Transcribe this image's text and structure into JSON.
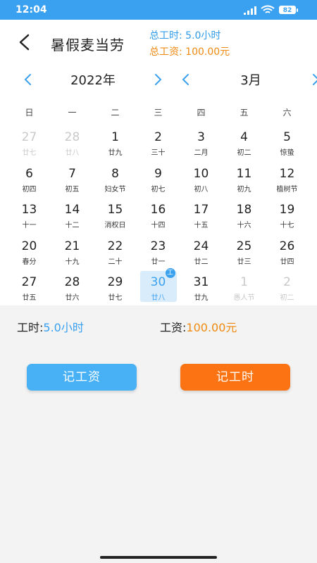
{
  "status_bar": {
    "time": "12:04",
    "battery": "82"
  },
  "header": {
    "title": "暑假麦当劳",
    "total_hours": "总工时: 5.0小时",
    "total_wage": "总工资: 100.00元"
  },
  "calendar": {
    "year_label": "2022年",
    "month_label": "3月",
    "weekdays": [
      "日",
      "一",
      "二",
      "三",
      "四",
      "五",
      "六"
    ],
    "days": [
      {
        "day": "27",
        "lunar": "廿七",
        "dim": true
      },
      {
        "day": "28",
        "lunar": "廿八",
        "dim": true
      },
      {
        "day": "1",
        "lunar": "廿九"
      },
      {
        "day": "2",
        "lunar": "三十"
      },
      {
        "day": "3",
        "lunar": "二月"
      },
      {
        "day": "4",
        "lunar": "初二"
      },
      {
        "day": "5",
        "lunar": "惊蛰"
      },
      {
        "day": "6",
        "lunar": "初四"
      },
      {
        "day": "7",
        "lunar": "初五"
      },
      {
        "day": "8",
        "lunar": "妇女节"
      },
      {
        "day": "9",
        "lunar": "初七"
      },
      {
        "day": "10",
        "lunar": "初八"
      },
      {
        "day": "11",
        "lunar": "初九"
      },
      {
        "day": "12",
        "lunar": "植树节"
      },
      {
        "day": "13",
        "lunar": "十一"
      },
      {
        "day": "14",
        "lunar": "十二"
      },
      {
        "day": "15",
        "lunar": "消权日"
      },
      {
        "day": "16",
        "lunar": "十四"
      },
      {
        "day": "17",
        "lunar": "十五"
      },
      {
        "day": "18",
        "lunar": "十六"
      },
      {
        "day": "19",
        "lunar": "十七"
      },
      {
        "day": "20",
        "lunar": "春分"
      },
      {
        "day": "21",
        "lunar": "十九"
      },
      {
        "day": "22",
        "lunar": "二十"
      },
      {
        "day": "23",
        "lunar": "廿一"
      },
      {
        "day": "24",
        "lunar": "廿二"
      },
      {
        "day": "25",
        "lunar": "廿三"
      },
      {
        "day": "26",
        "lunar": "廿四"
      },
      {
        "day": "27",
        "lunar": "廿五"
      },
      {
        "day": "28",
        "lunar": "廿六"
      },
      {
        "day": "29",
        "lunar": "廿七"
      },
      {
        "day": "30",
        "lunar": "廿八",
        "selected": true,
        "badge": "工"
      },
      {
        "day": "31",
        "lunar": "廿九"
      },
      {
        "day": "1",
        "lunar": "愚人节",
        "dim": true
      },
      {
        "day": "2",
        "lunar": "初二",
        "dim": true
      }
    ]
  },
  "summary": {
    "hours_label": "工时:",
    "hours_value": "5.0小时",
    "wage_label": "工资:",
    "wage_value": "100.00元"
  },
  "buttons": {
    "record_wage": "记工资",
    "record_hours": "记工时"
  },
  "colors": {
    "accent_blue": "#3aa0f0",
    "accent_orange": "#ef8a12"
  }
}
